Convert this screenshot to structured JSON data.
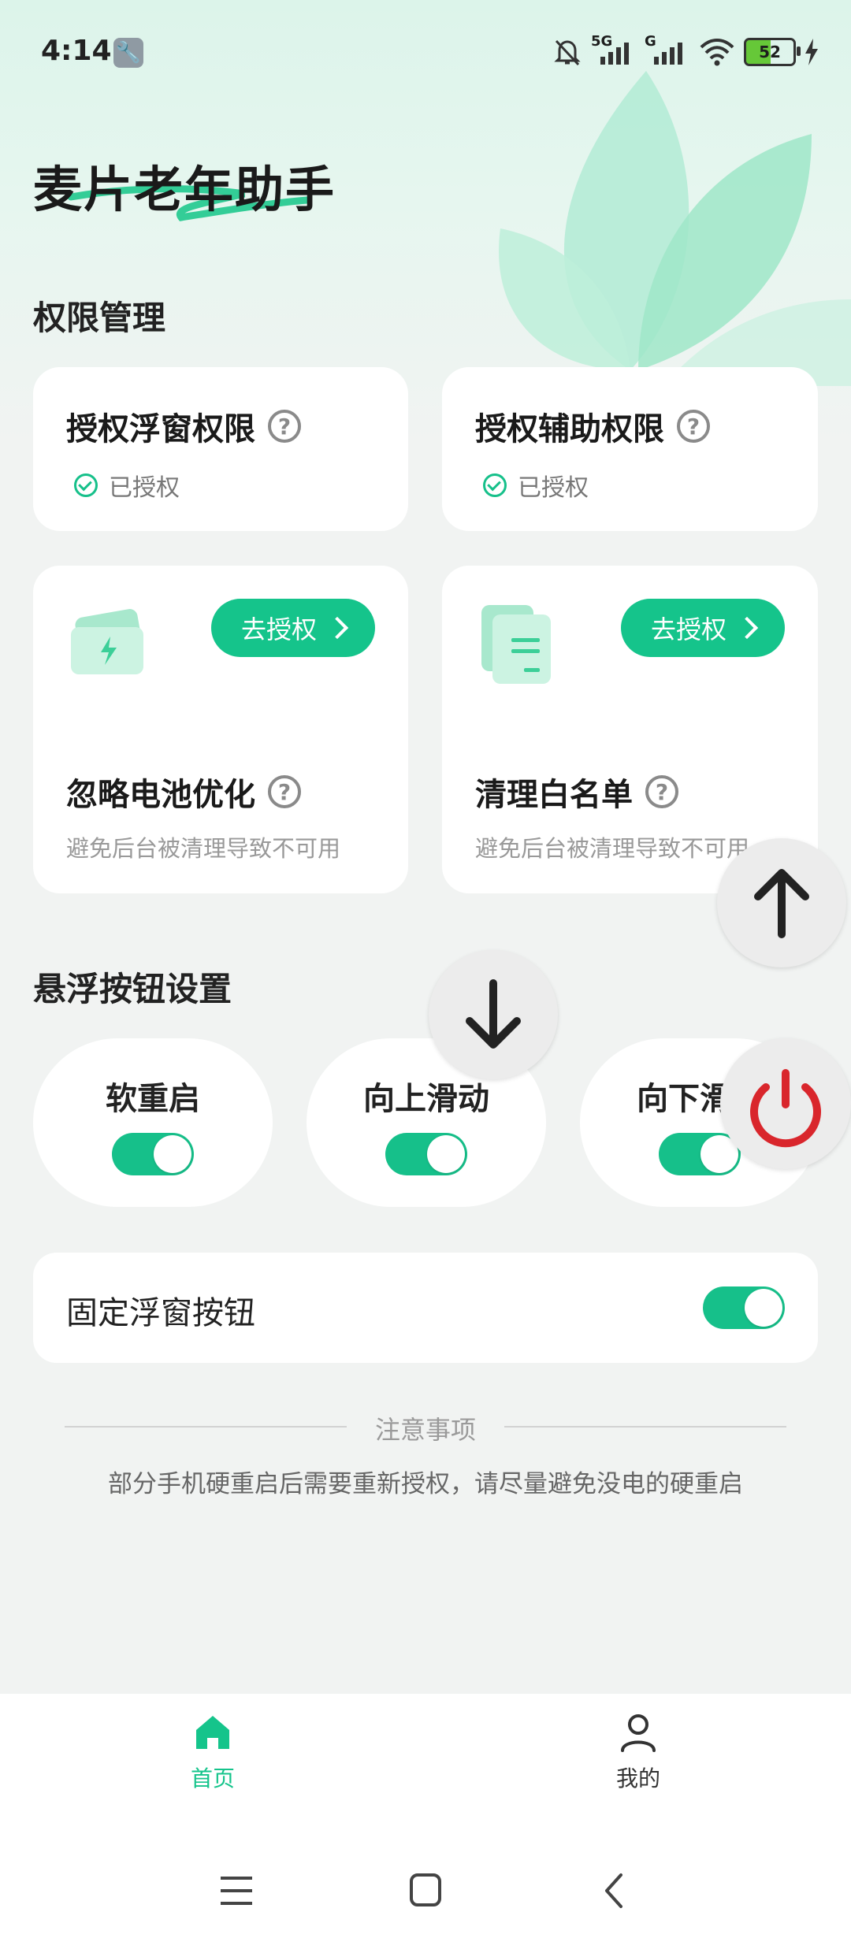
{
  "status_bar": {
    "time": "4:14",
    "battery": "52",
    "signal_1": "5G",
    "signal_2": "G"
  },
  "app": {
    "title": "麦片老年助手"
  },
  "permissions": {
    "section_title": "权限管理",
    "floating_window": {
      "title": "授权浮窗权限",
      "status": "已授权"
    },
    "accessibility": {
      "title": "授权辅助权限",
      "status": "已授权"
    },
    "battery": {
      "title": "忽略电池优化",
      "button": "去授权",
      "desc": "避免后台被清理导致不可用"
    },
    "whitelist": {
      "title": "清理白名单",
      "button": "去授权",
      "desc": "避免后台被清理导致不可用"
    }
  },
  "float_settings": {
    "section_title": "悬浮按钮设置",
    "items": [
      {
        "label": "软重启",
        "enabled": true
      },
      {
        "label": "向上滑动",
        "enabled": true
      },
      {
        "label": "向下滑动",
        "enabled": true
      }
    ],
    "fixed": {
      "label": "固定浮窗按钮",
      "enabled": true
    }
  },
  "notice": {
    "title": "注意事项",
    "text": "部分手机硬重启后需要重新授权，请尽量避免没电的硬重启"
  },
  "bottom_nav": {
    "home": "首页",
    "mine": "我的"
  },
  "colors": {
    "accent": "#15c48b",
    "power": "#d9262c"
  }
}
